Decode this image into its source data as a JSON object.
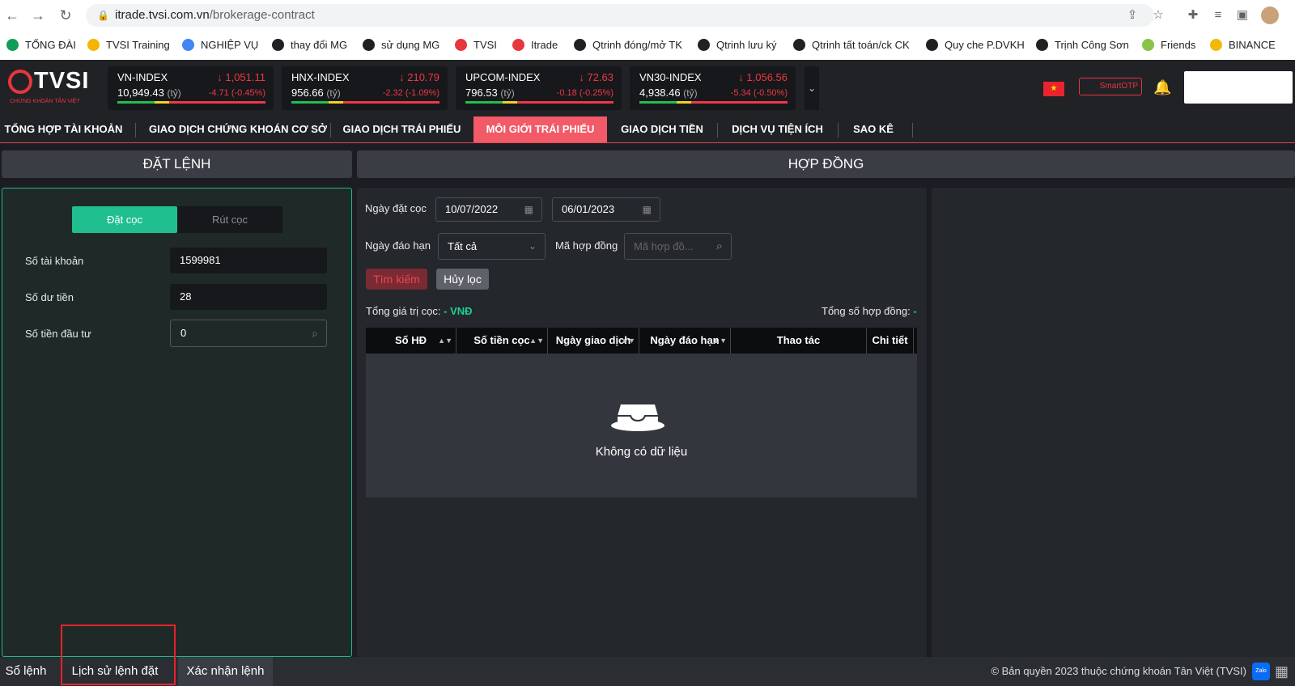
{
  "browser": {
    "url_host": "itrade.tvsi.com.vn",
    "url_path": "/brokerage-contract"
  },
  "bookmarks": [
    {
      "label": "TỔNG ĐÀI",
      "color": "#0f9d58"
    },
    {
      "label": "TVSI Training",
      "color": "#f4b400"
    },
    {
      "label": "NGHIỆP VỤ",
      "color": "#4285f4"
    },
    {
      "label": "thay đổi MG",
      "color": "#202124"
    },
    {
      "label": "sử dụng MG",
      "color": "#202124"
    },
    {
      "label": "TVSI",
      "color": "#e8363d"
    },
    {
      "label": "Itrade",
      "color": "#e8363d"
    },
    {
      "label": "Qtrinh đóng/mở TK",
      "color": "#202124"
    },
    {
      "label": "Qtrinh lưu ký",
      "color": "#202124"
    },
    {
      "label": "Qtrinh tất toán/ck CK",
      "color": "#202124"
    },
    {
      "label": "Quy che P.DVKH",
      "color": "#202124"
    },
    {
      "label": "Trịnh Công Sơn",
      "color": "#202124"
    },
    {
      "label": "Friends",
      "color": "#8bc34a"
    },
    {
      "label": "BINANCE",
      "color": "#f0b90b"
    }
  ],
  "logo": {
    "text": "TVSI",
    "sub": "CHỨNG KHOÁN TÂN VIỆT"
  },
  "indices": [
    {
      "name": "VN-INDEX",
      "price": "↓ 1,051.11",
      "volume": "10,949.43",
      "unit": "(tỷ)",
      "change": "-4.71 (-0.45%)"
    },
    {
      "name": "HNX-INDEX",
      "price": "↓ 210.79",
      "volume": "956.66",
      "unit": "(tỷ)",
      "change": "-2.32 (-1.09%)"
    },
    {
      "name": "UPCOM-INDEX",
      "price": "↓ 72.63",
      "volume": "796.53",
      "unit": "(tỷ)",
      "change": "-0.18 (-0.25%)"
    },
    {
      "name": "VN30-INDEX",
      "price": "↓ 1,056.56",
      "volume": "4,938.46",
      "unit": "(tỷ)",
      "change": "-5.34 (-0.50%)"
    }
  ],
  "header": {
    "otp_label": "SmartOTP",
    "flag": "★"
  },
  "menu": [
    "TỔNG HỢP TÀI KHOẢN",
    "GIAO DỊCH CHỨNG KHOÁN CƠ SỞ",
    "GIAO DỊCH TRÁI PHIẾU",
    "MÔI GIỚI TRÁI PHIẾU",
    "GIAO DỊCH TIỀN",
    "DỊCH VỤ TIỆN ÍCH",
    "SAO KÊ"
  ],
  "left": {
    "title": "ĐẶT LỆNH",
    "tab_deposit": "Đặt cọc",
    "tab_withdraw": "Rút cọc",
    "account_label": "Số tài khoản",
    "account_value": "1599981",
    "balance_label": "Số dư tiền",
    "balance_value": "28",
    "invest_label": "Số tiền đầu tư",
    "invest_value": "0"
  },
  "center": {
    "title": "HỢP ĐỒNG",
    "deposit_date_label": "Ngày đặt cọc",
    "date_from": "10/07/2022",
    "date_to": "06/01/2023",
    "maturity_label": "Ngày đáo hạn",
    "maturity_value": "Tất cả",
    "contract_code_label": "Mã hợp đồng",
    "contract_code_placeholder": "Mã hợp đồ...",
    "search_btn": "Tìm kiếm",
    "clear_btn": "Hủy lọc",
    "total_value_label": "Tổng giá trị cọc:",
    "total_value": "- VNĐ",
    "total_count_label": "Tổng số hợp đồng:",
    "total_count": "-",
    "columns": [
      "Số HĐ",
      "Số tiền cọc",
      "Ngày giao dịch",
      "Ngày đáo hạn",
      "Thao tác",
      "Chi tiết"
    ],
    "empty_text": "Không có dữ liệu"
  },
  "footer": {
    "tabs": [
      "Sổ lệnh",
      "Lịch sử lệnh đặt",
      "Xác nhận lệnh"
    ],
    "copyright": "© Bản quyền 2023 thuộc chứng khoán Tân Việt (TVSI)",
    "zalo": "Zalo"
  }
}
